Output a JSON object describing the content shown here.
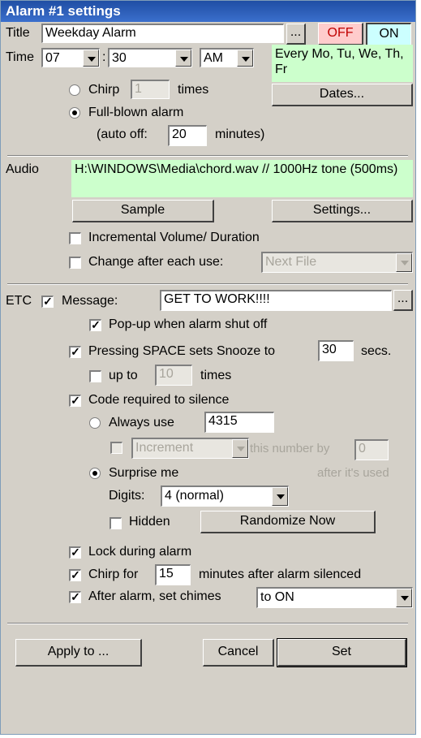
{
  "window": {
    "title": "Alarm #1 settings"
  },
  "title_row": {
    "label": "Title",
    "value": "Weekday Alarm",
    "browse": "...",
    "off": "OFF",
    "on": "ON"
  },
  "time_row": {
    "label": "Time",
    "hour": "07",
    "sep": ":",
    "minute": "30",
    "ampm": "AM",
    "schedule": "Every Mo, Tu, We, Th, Fr",
    "dates_button": "Dates..."
  },
  "chirp": {
    "label": "Chirp",
    "value": "1",
    "suffix": "times"
  },
  "full_blown": {
    "label": "Full-blown alarm",
    "auto_off_prefix": "(auto off:",
    "auto_off_value": "20",
    "auto_off_suffix": "minutes)"
  },
  "audio": {
    "label": "Audio",
    "file": "H:\\WINDOWS\\Media\\chord.wav // 1000Hz tone (500ms)",
    "sample_button": "Sample",
    "settings_button": "Settings...",
    "incremental": "Incremental Volume/ Duration",
    "change_after": "Change after each use:",
    "change_mode": "Next File"
  },
  "etc": {
    "label": "ETC",
    "message_label": "Message:",
    "message_value": "GET TO WORK!!!!",
    "message_browse": "...",
    "popup": "Pop-up when alarm shut off",
    "snooze_label": "Pressing SPACE sets Snooze to",
    "snooze_value": "30",
    "snooze_suffix": "secs.",
    "upto_label": "up to",
    "upto_value": "10",
    "upto_suffix": "times",
    "code_required": "Code required to silence",
    "always_use": "Always use",
    "always_value": "4315",
    "increment": "Increment",
    "increment_by": "this number by",
    "increment_value": "0",
    "after_used": "after it's used",
    "surprise": "Surprise me",
    "digits_label": "Digits:",
    "digits_value": "4 (normal)",
    "hidden": "Hidden",
    "randomize": "Randomize Now",
    "lock": "Lock during alarm",
    "chirp_for": "Chirp for",
    "chirp_for_value": "15",
    "chirp_for_suffix": "minutes after alarm silenced",
    "chimes_label": "After alarm, set chimes",
    "chimes_value": "to ON"
  },
  "footer": {
    "apply": "Apply to ...",
    "cancel": "Cancel",
    "set": "Set"
  },
  "colors": {
    "title_bar": "#1f4ea4",
    "highlight": "#ccffcc",
    "off_bg": "#ffcccc",
    "on_bg": "#ccffff",
    "face": "#d4d0c8"
  }
}
